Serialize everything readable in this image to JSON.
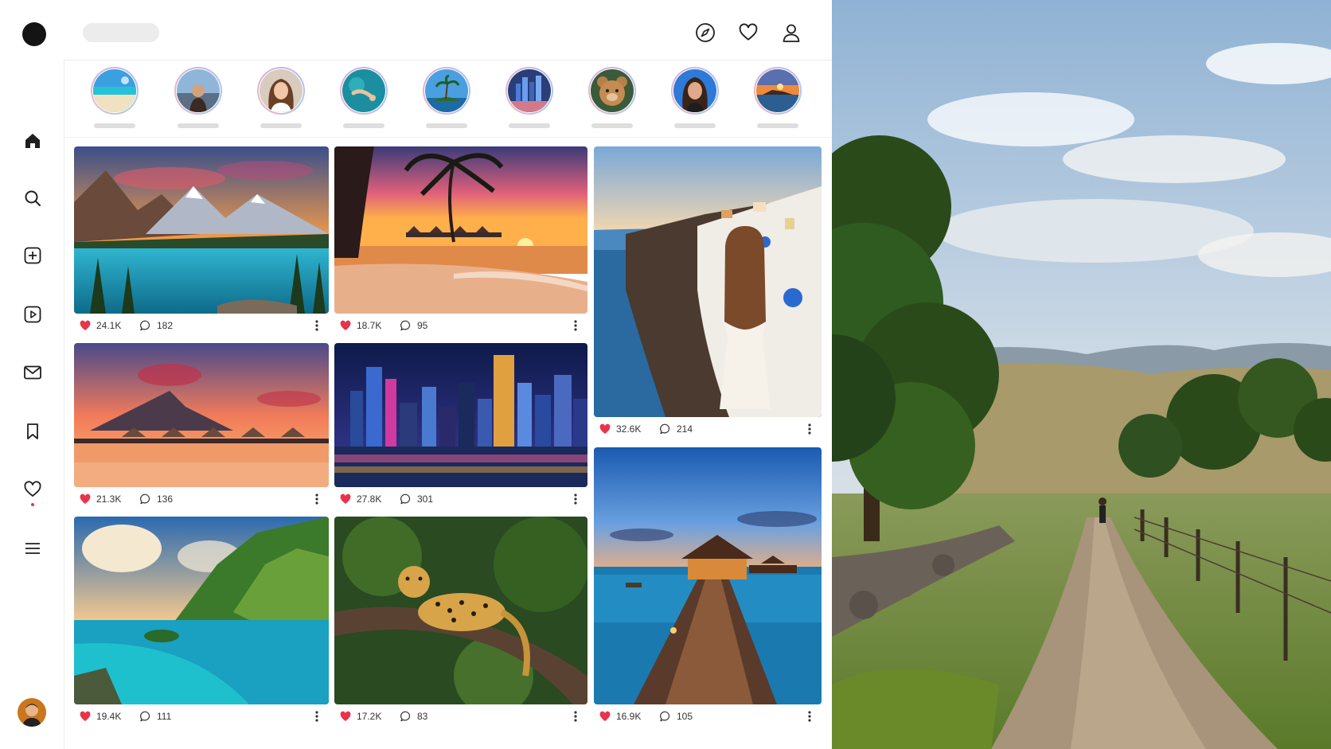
{
  "colors": {
    "accent_red": "#e8344a",
    "icon_dark": "#1f1f1f",
    "divider": "#ececec"
  },
  "sidebar": {
    "items": [
      {
        "name": "home-icon"
      },
      {
        "name": "search-icon"
      },
      {
        "name": "create-post-icon"
      },
      {
        "name": "reels-icon"
      },
      {
        "name": "messages-icon"
      },
      {
        "name": "saved-bookmark-icon"
      },
      {
        "name": "notifications-heart-icon"
      },
      {
        "name": "menu-icon"
      }
    ]
  },
  "topbar": {
    "icons": [
      "explore-compass-icon",
      "activity-heart-icon",
      "profile-user-icon"
    ]
  },
  "stories": [
    "beach",
    "woman-coast",
    "woman-portrait",
    "swimmer",
    "palm-island",
    "city-skyline",
    "teddy-bear",
    "woman-portrait-2",
    "sunset-harbor"
  ],
  "posts": [
    {
      "scene": "mountain-lake",
      "likes": "24.1K",
      "comments": "182"
    },
    {
      "scene": "tropical-beach-sunset",
      "likes": "18.7K",
      "comments": "95"
    },
    {
      "scene": "santorini-woman",
      "likes": "32.6K",
      "comments": "214"
    },
    {
      "scene": "overwater-bungalows-sunset",
      "likes": "21.3K",
      "comments": "136"
    },
    {
      "scene": "city-skyline-night",
      "likes": "27.8K",
      "comments": "301"
    },
    {
      "scene": "tropical-coast-cliffs",
      "likes": "19.4K",
      "comments": "111"
    },
    {
      "scene": "leopard-on-branch",
      "likes": "17.2K",
      "comments": "83"
    },
    {
      "scene": "pier-bungalow-dusk",
      "likes": "16.9K",
      "comments": "105"
    }
  ]
}
